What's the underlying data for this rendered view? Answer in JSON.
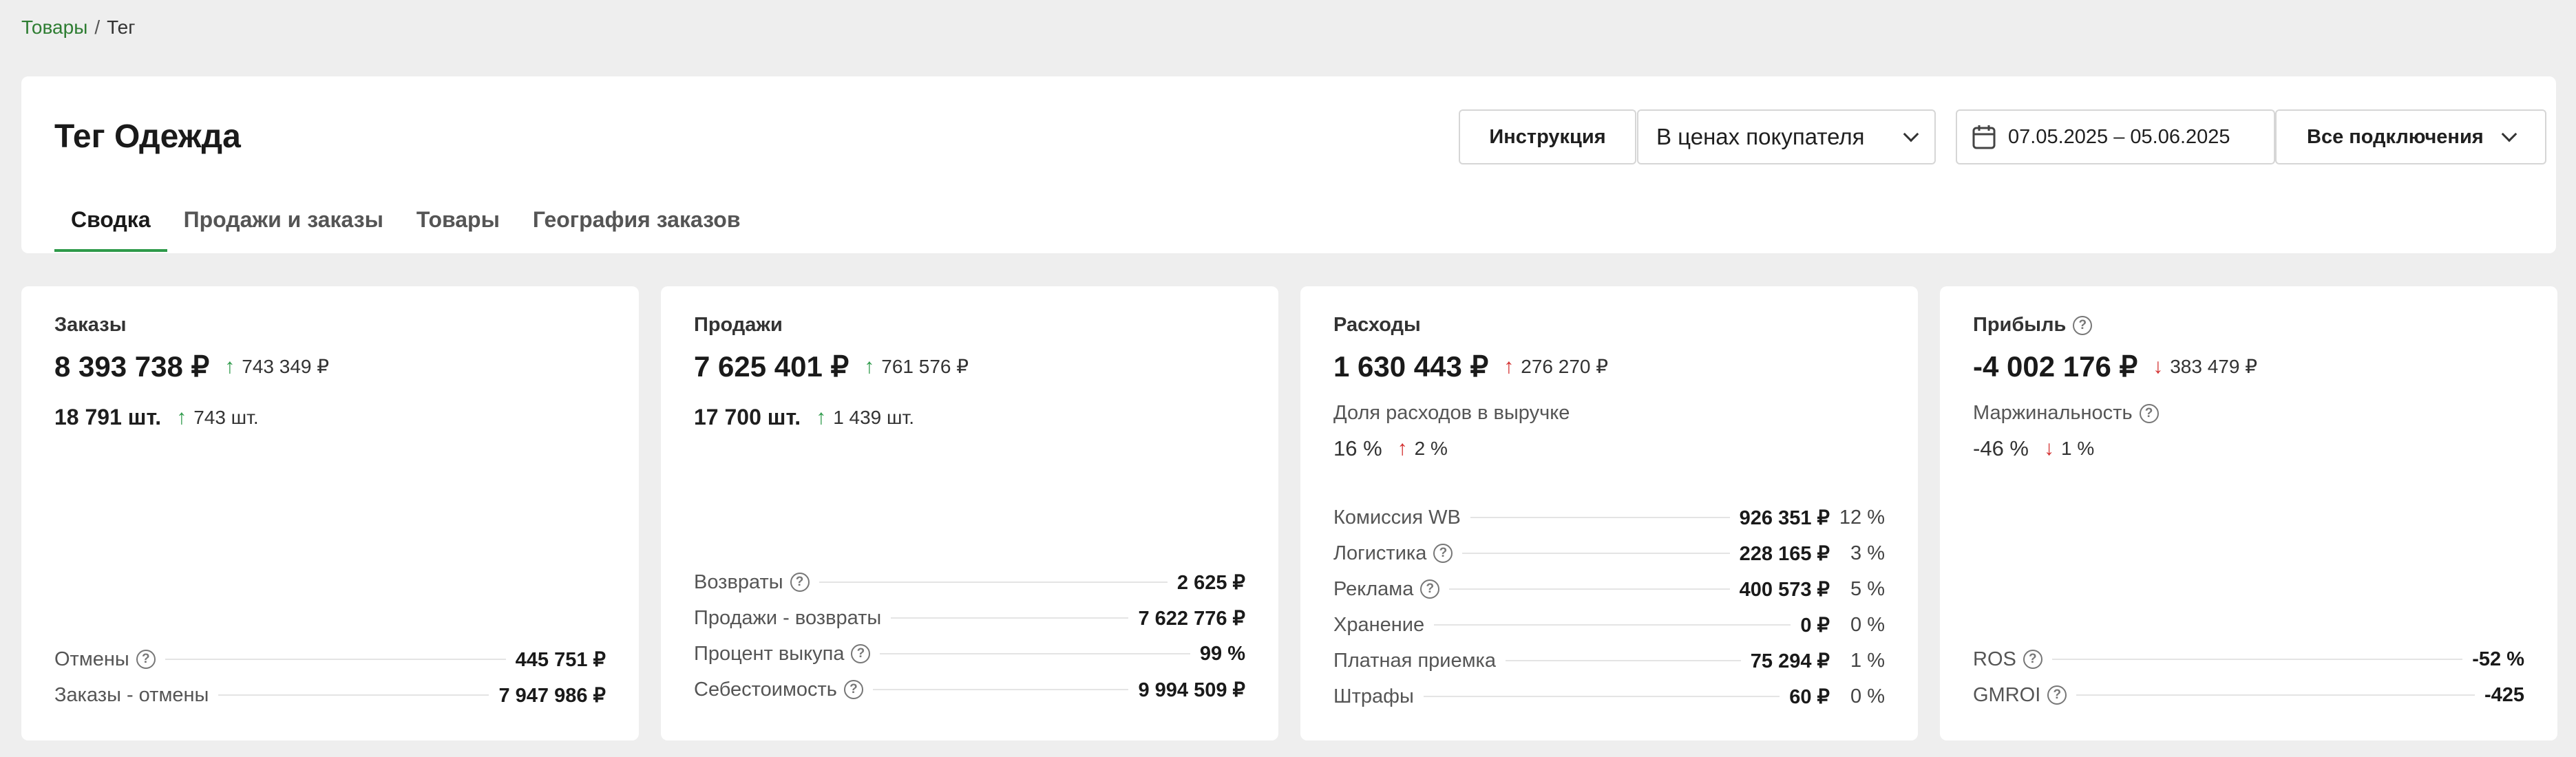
{
  "breadcrumb": {
    "link": "Товары",
    "separator": "/",
    "current": "Тег"
  },
  "header": {
    "title": "Тег Одежда",
    "instruction_button": "Инструкция",
    "price_select": "В ценах покупателя",
    "date_range": "07.05.2025 – 05.06.2025",
    "connections_select": "Все подключения"
  },
  "tabs": [
    "Сводка",
    "Продажи и заказы",
    "Товары",
    "География заказов"
  ],
  "cards": {
    "orders": {
      "title": "Заказы",
      "main": "8 393 738 ₽",
      "main_delta": "743 349 ₽",
      "sub": "18 791 шт.",
      "sub_delta": "743 шт.",
      "rows": [
        {
          "label": "Отмены",
          "value": "445 751 ₽"
        },
        {
          "label": "Заказы - отмены",
          "value": "7 947 986 ₽"
        }
      ]
    },
    "sales": {
      "title": "Продажи",
      "main": "7 625 401 ₽",
      "main_delta": "761 576 ₽",
      "sub": "17 700 шт.",
      "sub_delta": "1 439 шт.",
      "rows": [
        {
          "label": "Возвраты",
          "value": "2 625 ₽"
        },
        {
          "label": "Продажи - возвраты",
          "value": "7 622 776 ₽"
        },
        {
          "label": "Процент выкупа",
          "value": "99 %"
        },
        {
          "label": "Себестоимость",
          "value": "9 994 509 ₽"
        }
      ]
    },
    "expenses": {
      "title": "Расходы",
      "main": "1 630 443 ₽",
      "main_delta": "276 270 ₽",
      "share_label": "Доля расходов в выручке",
      "share_value": "16 %",
      "share_delta": "2 %",
      "rows": [
        {
          "label": "Комиссия WB",
          "value": "926 351 ₽",
          "pct": "12 %"
        },
        {
          "label": "Логистика",
          "value": "228 165 ₽",
          "pct": "3 %"
        },
        {
          "label": "Реклама",
          "value": "400 573 ₽",
          "pct": "5 %"
        },
        {
          "label": "Хранение",
          "value": "0 ₽",
          "pct": "0 %"
        },
        {
          "label": "Платная приемка",
          "value": "75 294 ₽",
          "pct": "1 %"
        },
        {
          "label": "Штрафы",
          "value": "60 ₽",
          "pct": "0 %"
        }
      ]
    },
    "profit": {
      "title": "Прибыль",
      "main": "-4 002 176 ₽",
      "main_delta": "383 479 ₽",
      "margin_label": "Маржинальность",
      "margin_value": "-46 %",
      "margin_delta": "1 %",
      "rows": [
        {
          "label": "ROS",
          "value": "-52 %"
        },
        {
          "label": "GMROI",
          "value": "-425"
        }
      ]
    }
  },
  "colors": {
    "accent_green": "#2e9a4a",
    "negative_red": "#d32f2f",
    "link_green": "#2e7d32"
  }
}
